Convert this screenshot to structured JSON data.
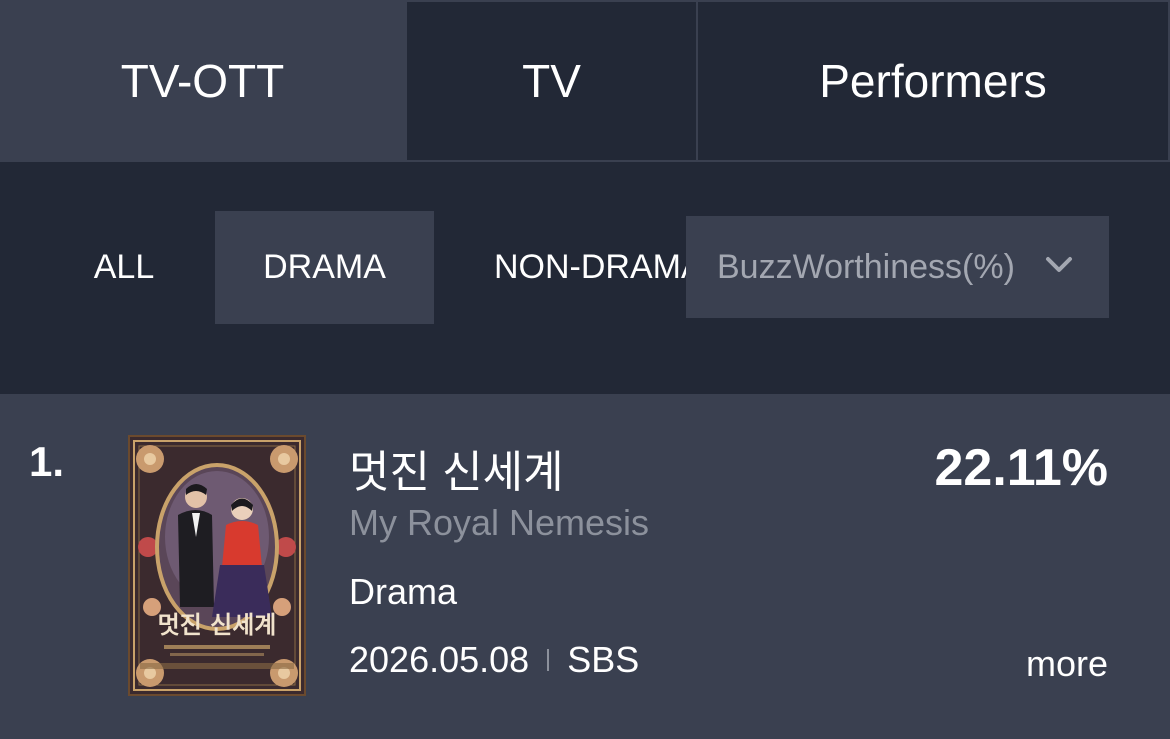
{
  "tabs": [
    {
      "label": "TV-OTT",
      "active": true
    },
    {
      "label": "TV",
      "active": false
    },
    {
      "label": "Performers",
      "active": false
    }
  ],
  "filters": {
    "chips": [
      "ALL",
      "DRAMA",
      "NON-DRAMA"
    ],
    "selected_chip": "DRAMA",
    "sort_select": {
      "value": "BuzzWorthiness(%)",
      "icon": "chevron-down-icon"
    }
  },
  "items": [
    {
      "rank": "1.",
      "title_ko": "멋진 신세계",
      "title_en": "My Royal Nemesis",
      "genre": "Drama",
      "date": "2026.05.08",
      "channel": "SBS",
      "percent": "22.11%",
      "more_label": "more",
      "poster": {
        "title_text": "멋진 신세계"
      }
    }
  ],
  "colors": {
    "background": "#222836",
    "panel": "#3a4050",
    "muted_text": "#8c919c"
  }
}
